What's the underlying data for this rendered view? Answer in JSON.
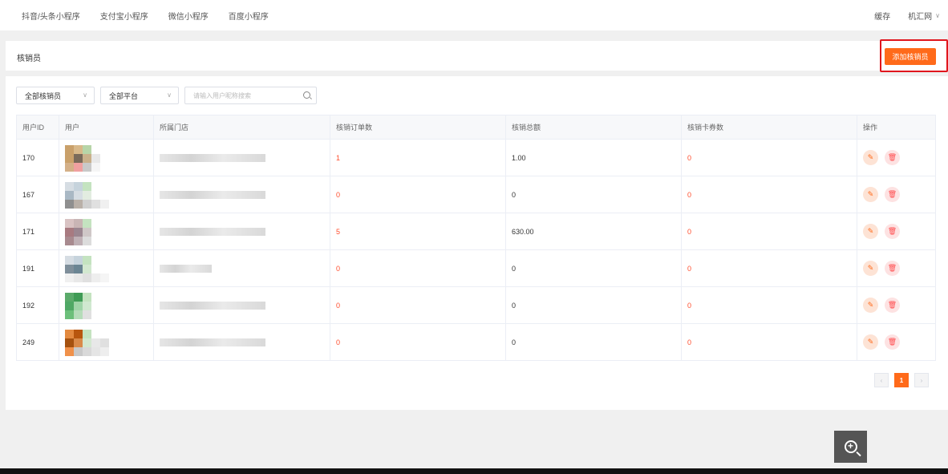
{
  "nav": {
    "items": [
      "抖音/头条小程序",
      "支付宝小程序",
      "微信小程序",
      "百度小程序"
    ],
    "cache": "缓存",
    "user": "机汇网"
  },
  "header": {
    "title": "核销员",
    "add_button": "添加核销员"
  },
  "filters": {
    "role_select": "全部核销员",
    "platform_select": "全部平台",
    "search_placeholder": "请输入用户昵称搜索"
  },
  "table": {
    "columns": [
      "用户ID",
      "用户",
      "所属门店",
      "核销订单数",
      "核销总额",
      "核销卡券数",
      "操作"
    ],
    "rows": [
      {
        "id": "170",
        "orders": "1",
        "total": "1.00",
        "cards": "0"
      },
      {
        "id": "167",
        "orders": "0",
        "total": "0",
        "cards": "0"
      },
      {
        "id": "171",
        "orders": "5",
        "total": "630.00",
        "cards": "0"
      },
      {
        "id": "191",
        "orders": "0",
        "total": "0",
        "cards": "0"
      },
      {
        "id": "192",
        "orders": "0",
        "total": "0",
        "cards": "0"
      },
      {
        "id": "249",
        "orders": "0",
        "total": "0",
        "cards": "0"
      }
    ]
  },
  "pagination": {
    "prev": "‹",
    "current": "1",
    "next": "›"
  },
  "colors": {
    "accent": "#ff6a1a",
    "highlight": "#e0161d",
    "value_red": "#ff4d2d"
  }
}
